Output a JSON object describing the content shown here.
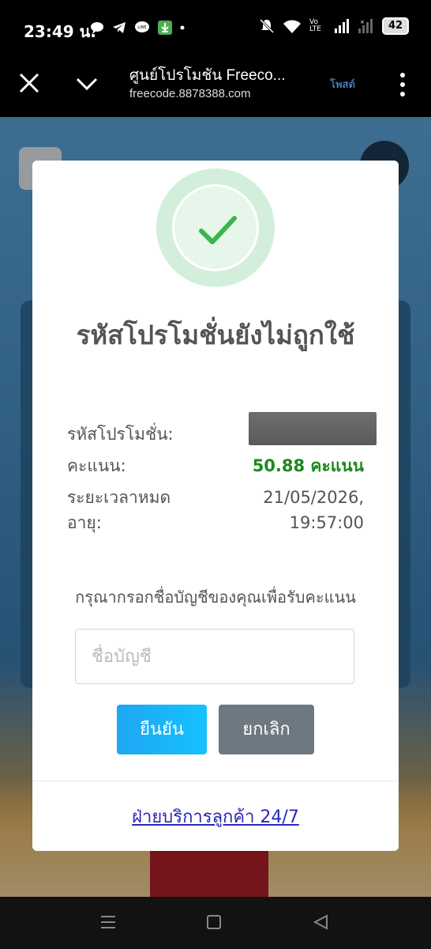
{
  "status_bar": {
    "time": "23:49 น.",
    "battery": "42",
    "network_label": "Vo LTE"
  },
  "browser": {
    "title": "ศูนย์โปรโมชัน Freeco...",
    "url": "freecode.8878388.com",
    "post_button": "โพสต์"
  },
  "modal": {
    "title": "รหัสโปรโมชั่นยังไม่ถูกใช้",
    "rows": [
      {
        "label": "รหัสโปรโมชั่น:",
        "value": ""
      },
      {
        "label": "คะแนน:",
        "value": "50.88 คะแนน"
      },
      {
        "label": "ระยะเวลาหมดอายุ:",
        "value": "21/05/2026, 19:57:00"
      }
    ],
    "prompt": "กรุณากรอกชื่อบัญชีของคุณเพื่อรับคะแนน",
    "input_placeholder": "ชื่อบัญชี",
    "confirm_label": "ยืนยัน",
    "cancel_label": "ยกเลิก",
    "support_link": "ฝ่ายบริการลูกค้า 24/7"
  },
  "colors": {
    "accent": "#15c2ff",
    "success": "#1b8a1b",
    "cancel": "#6e7881"
  }
}
